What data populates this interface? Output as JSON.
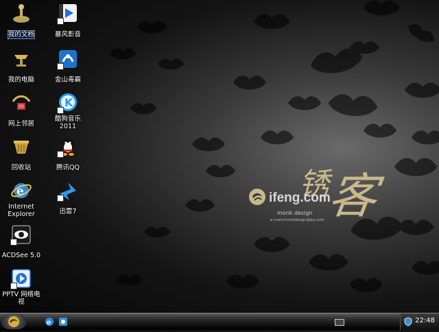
{
  "desktop_icons": [
    {
      "label": "我的文档",
      "icon": "my-documents-icon"
    },
    {
      "label": "暴风影音",
      "icon": "baofeng-player-icon"
    },
    {
      "label": "我的电脑",
      "icon": "my-computer-icon"
    },
    {
      "label": "金山毒霸",
      "icon": "kingsoft-antivirus-icon"
    },
    {
      "label": "网上邻居",
      "icon": "network-neighborhood-icon"
    },
    {
      "label": "酷狗音乐2011",
      "icon": "kugou-music-icon"
    },
    {
      "label": "回收站",
      "icon": "recycle-bin-icon"
    },
    {
      "label": "腾讯QQ",
      "icon": "qq-icon"
    },
    {
      "label": "Internet Explorer",
      "icon": "internet-explorer-icon"
    },
    {
      "label": "迅雷7",
      "icon": "thunder-icon"
    },
    {
      "label": "ACDSee 5.0",
      "icon": "acdsee-icon"
    },
    {
      "label": "PPTV 网络电视",
      "icon": "pptv-icon"
    }
  ],
  "wallpaper": {
    "cn_word_1": "锈",
    "cn_word_2": "客",
    "site": "ifeng.com",
    "designer": "monk design",
    "email": "e-mail:monkdesign@qq.com",
    "accent_gold": "#c9b88a"
  },
  "taskbar": {
    "start_icon": "ifeng-start-icon",
    "quick_launch": [
      "internet-explorer-icon",
      "show-desktop-icon"
    ],
    "tray_icons": [
      "keyboard-icon",
      "security-shield-icon"
    ],
    "clock": "22:48"
  }
}
